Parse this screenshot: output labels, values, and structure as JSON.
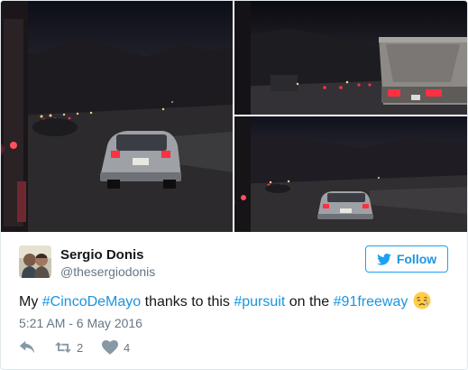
{
  "author": {
    "name": "Sergio Donis",
    "handle": "@thesergiodonis"
  },
  "follow": {
    "label": "Follow"
  },
  "tweet": {
    "parts": [
      {
        "text": "My ",
        "hashtag": false
      },
      {
        "text": "#CincoDeMayo",
        "hashtag": true
      },
      {
        "text": " thanks to this ",
        "hashtag": false
      },
      {
        "text": "#pursuit",
        "hashtag": true
      },
      {
        "text": " on the ",
        "hashtag": false
      },
      {
        "text": "#91freeway",
        "hashtag": true
      }
    ],
    "emoji": "sad-relieved-face-icon",
    "timestamp": "5:21 AM - 6 May 2016"
  },
  "actions": {
    "retweet_count": "2",
    "like_count": "4"
  },
  "colors": {
    "link": "#1b95e0",
    "text": "#14171a",
    "muted": "#657786",
    "icon": "#8899a6",
    "border": "#e1e8ed"
  },
  "photos": [
    {
      "name": "photo-traffic-night-1"
    },
    {
      "name": "photo-traffic-night-2"
    },
    {
      "name": "photo-traffic-night-3"
    }
  ]
}
